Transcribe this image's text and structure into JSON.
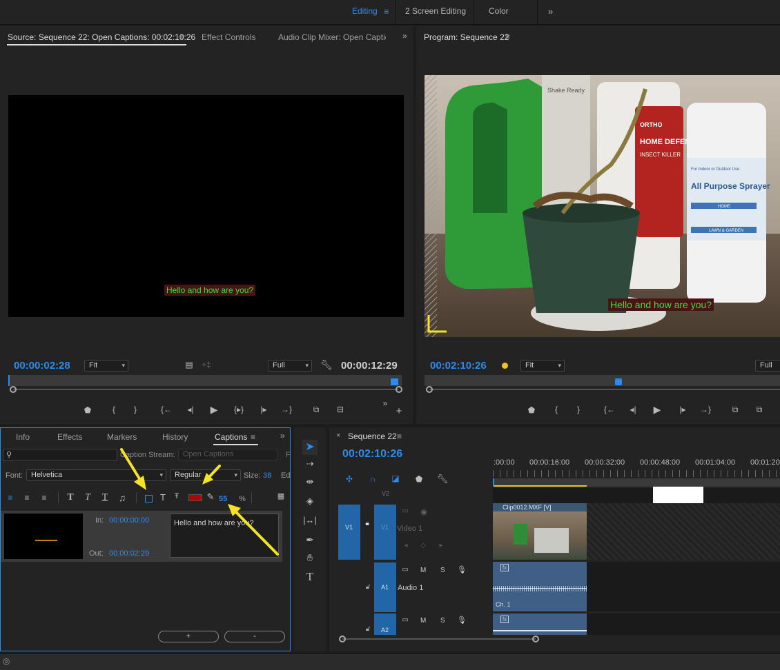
{
  "workspaces": [
    {
      "label": "Editing",
      "active": true
    },
    {
      "label": "2 Screen Editing"
    },
    {
      "label": "Color"
    }
  ],
  "source": {
    "tabs": [
      "Source: Sequence 22: Open Captions: 00:02:10:26",
      "Effect Controls",
      "Audio Clip Mixer: Open Captions"
    ],
    "caption": "Hello and how are you?",
    "timecode_left": "00:00:02:28",
    "timecode_right": "00:00:12:29",
    "fit": "Fit",
    "resolution": "Full"
  },
  "program": {
    "title": "Program: Sequence 22",
    "caption": "Hello and how are you?",
    "timecode": "00:02:10:26",
    "fit": "Fit",
    "resolution": "Full",
    "bottle_labels": {
      "left": "Shake Ready",
      "center": "HOME DEFENSE",
      "center_brand": "ORTHO",
      "center_sub": "INSECT KILLER",
      "right": "All Purpose Sprayer",
      "right_sub": "For Indoor or Outdoor Use",
      "right_home": "HOME",
      "right_lawn": "LAWN & GARDEN"
    }
  },
  "captions_panel": {
    "tabs": [
      "Info",
      "Effects",
      "Markers",
      "History",
      "Captions"
    ],
    "search_placeholder": "",
    "stream_label": "Caption Stream:",
    "stream_value": "Open Captions",
    "font_label": "Font:",
    "font_value": "Helvetica",
    "style_value": "Regular",
    "size_label": "Size:",
    "size_value": "38",
    "edge_label": "Ed",
    "opacity_value": "55",
    "opacity_unit": "%",
    "in_label": "In:",
    "in_value": "00:00:00:00",
    "out_label": "Out:",
    "out_value": "00:00:02:29",
    "caption_text": "Hello and how are you?",
    "add_label": "+",
    "remove_label": "-",
    "bg_color": "#b30000"
  },
  "timeline": {
    "title": "Sequence 22",
    "timecode": "00:02:10:26",
    "ruler_labels": [
      ":00:00",
      "00:00:16:00",
      "00:00:32:00",
      "00:00:48:00",
      "00:01:04:00",
      "00:01:20"
    ],
    "tracks": {
      "v2": "V2",
      "v1": "V1",
      "v1_name": "Video 1",
      "a1": "A1",
      "a1_name": "Audio 1",
      "a2": "A2"
    },
    "clip_label": "Clip0012.MXF [V]",
    "audio_channel": "Ch. 1",
    "mute": "M",
    "solo": "S"
  },
  "colors": {
    "accent": "#2d8ceb",
    "highlight": "#f7e22b",
    "caption_green": "#35e23a"
  }
}
